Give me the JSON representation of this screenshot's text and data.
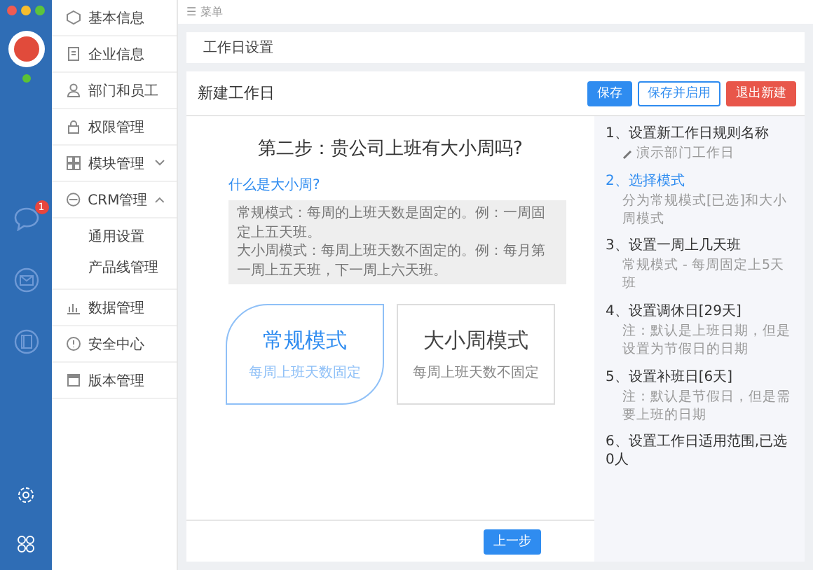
{
  "rail": {
    "online": true,
    "badge": "1"
  },
  "sidebar": {
    "items": [
      {
        "label": "基本信息",
        "kind": "link"
      },
      {
        "label": "企业信息",
        "kind": "link"
      },
      {
        "label": "部门和员工",
        "kind": "link"
      },
      {
        "label": "权限管理",
        "kind": "link"
      },
      {
        "label": "模块管理",
        "kind": "group",
        "expanded": false
      },
      {
        "label": "CRM管理",
        "kind": "group",
        "expanded": true,
        "children": [
          {
            "label": "通用设置"
          },
          {
            "label": "产品线管理"
          }
        ]
      },
      {
        "label": "数据管理",
        "kind": "link"
      },
      {
        "label": "安全中心",
        "kind": "link"
      },
      {
        "label": "版本管理",
        "kind": "link"
      }
    ]
  },
  "menu_bar": {
    "icon": "☰",
    "label": "菜单"
  },
  "page_card": {
    "title": "工作日设置"
  },
  "panel": {
    "title": "新建工作日",
    "buttons": [
      {
        "label": "保存",
        "kind": "primary"
      },
      {
        "label": "保存并启用",
        "kind": "outline"
      },
      {
        "label": "退出新建",
        "kind": "danger"
      }
    ]
  },
  "question": "第二步：贵公司上班有大小周吗?",
  "help_link": "什么是大小周?",
  "help_text": [
    "常规模式：每周的上班天数是固定的。例：一周固定上五天班。",
    "大小周模式：每周上班天数不固定的。例：每月第一周上五天班，下一周上六天班。"
  ],
  "modes": [
    {
      "title": "常规模式",
      "subtitle": "每周上班天数固定",
      "selected": true
    },
    {
      "title": "大小周模式",
      "subtitle": "每周上班天数不固定",
      "selected": false
    }
  ],
  "footer_buttons": [
    {
      "label": "上一步"
    }
  ],
  "steps": [
    {
      "title": "1、设置新工作日规则名称",
      "note": "演示部门工作日",
      "kind": "editable",
      "selected": false
    },
    {
      "title": "2、选择模式",
      "note": "分为常规模式[已选]和大小周模式",
      "kind": "plain",
      "selected": true
    },
    {
      "title": "3、设置一周上几天班",
      "note": "常规模式 - 每周固定上5天班",
      "kind": "plain",
      "selected": false
    },
    {
      "title": "4、设置调休日[29天]",
      "note": "注：默认是上班日期，但是设置为节假日的日期",
      "kind": "plain",
      "selected": false
    },
    {
      "title": "5、设置补班日[6天]",
      "note": "注：默认是节假日，但是需要上班的日期",
      "kind": "plain",
      "selected": false
    },
    {
      "title": "6、设置工作日适用范围,已选0人",
      "kind": "plain",
      "selected": false
    }
  ]
}
